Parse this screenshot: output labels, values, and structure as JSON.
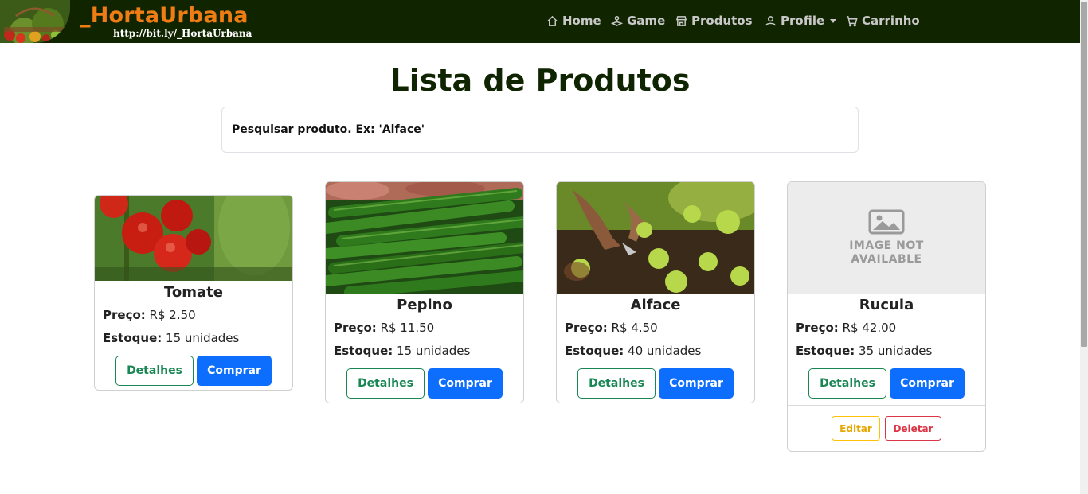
{
  "navbar": {
    "brand": "_HortaUrbana",
    "url": "http://bit.ly/_HortaUrbana",
    "links": {
      "home": "Home",
      "game": "Game",
      "produtos": "Produtos",
      "profile": "Profile",
      "carrinho": "Carrinho"
    },
    "icons": [
      "home-icon",
      "joystick-icon",
      "store-icon",
      "person-icon",
      "cart-icon"
    ]
  },
  "page": {
    "title": "Lista de Produtos",
    "search_placeholder": "Pesquisar produto. Ex: 'Alface'"
  },
  "labels": {
    "price": "Preço:",
    "stock": "Estoque:",
    "details": "Detalhes",
    "buy": "Comprar",
    "edit": "Editar",
    "delete": "Deletar",
    "image_na_line1": "IMAGE NOT",
    "image_na_line2": "AVAILABLE"
  },
  "products": [
    {
      "name": "Tomate",
      "price": "R$ 2.50",
      "stock": "15 unidades",
      "image": "tomato-photo"
    },
    {
      "name": "Pepino",
      "price": "R$ 11.50",
      "stock": "15 unidades",
      "image": "cucumber-photo"
    },
    {
      "name": "Alface",
      "price": "R$ 4.50",
      "stock": "40 unidades",
      "image": "lettuce-planting-photo"
    },
    {
      "name": "Rucula",
      "price": "R$ 42.00",
      "stock": "35 unidades",
      "image": "image-not-available"
    }
  ],
  "colors": {
    "navbar_bg": "#102400",
    "brand": "#f07d14",
    "title": "#0f2400",
    "success": "#198754",
    "primary": "#0d6efd",
    "warning": "#ffc107",
    "danger": "#dc3545"
  }
}
